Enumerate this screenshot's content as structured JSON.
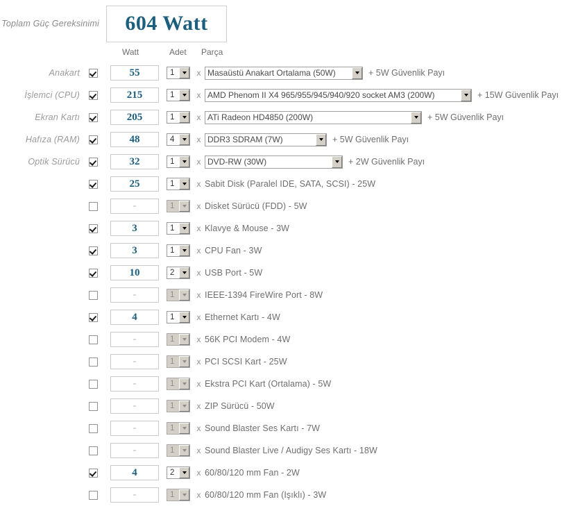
{
  "header": {
    "total_label": "Toplam Güç Gereksinimi",
    "total_value": "604 Watt",
    "accent_color": "#1b5e7e"
  },
  "columns": {
    "watt": "Watt",
    "qty": "Adet",
    "part": "Parça",
    "times": "x"
  },
  "rows": [
    {
      "label": "Anakart",
      "checked": true,
      "watt": "55",
      "qty": "1",
      "part_type": "select",
      "part": "Masaüstü Anakart Ortalama (50W)",
      "select_width": 228,
      "margin": "+ 5W Güvenlik Payı"
    },
    {
      "label": "İşlemci (CPU)",
      "checked": true,
      "watt": "215",
      "qty": "1",
      "part_type": "select",
      "part": "AMD Phenom II X4 965/955/945/940/920 socket AM3 (200W)",
      "select_width": 385,
      "margin": "+ 15W Güvenlik Payı"
    },
    {
      "label": "Ekran Kartı",
      "checked": true,
      "watt": "205",
      "qty": "1",
      "part_type": "select",
      "part": "ATi Radeon HD4850 (200W)",
      "select_width": 313,
      "margin": "+ 5W Güvenlik Payı"
    },
    {
      "label": "Hafıza (RAM)",
      "checked": true,
      "watt": "48",
      "qty": "4",
      "part_type": "select",
      "part": "DDR3 SDRAM (7W)",
      "select_width": 176,
      "margin": "+ 5W Güvenlik Payı"
    },
    {
      "label": "Optik Sürücü",
      "checked": true,
      "watt": "32",
      "qty": "1",
      "part_type": "select",
      "part": "DVD-RW (30W)",
      "select_width": 199,
      "margin": "+ 2W Güvenlik Payı"
    },
    {
      "label": "",
      "checked": true,
      "watt": "25",
      "qty": "1",
      "part_type": "text",
      "part": "Sabit Disk (Paralel IDE, SATA, SCSI) - 25W",
      "margin": ""
    },
    {
      "label": "",
      "checked": false,
      "watt": "-",
      "qty": "1",
      "part_type": "text",
      "part": "Disket Sürücü (FDD) - 5W",
      "margin": ""
    },
    {
      "label": "",
      "checked": true,
      "watt": "3",
      "qty": "1",
      "part_type": "text",
      "part": "Klavye & Mouse - 3W",
      "margin": ""
    },
    {
      "label": "",
      "checked": true,
      "watt": "3",
      "qty": "1",
      "part_type": "text",
      "part": "CPU Fan - 3W",
      "margin": ""
    },
    {
      "label": "",
      "checked": true,
      "watt": "10",
      "qty": "2",
      "part_type": "text",
      "part": "USB Port - 5W",
      "margin": ""
    },
    {
      "label": "",
      "checked": false,
      "watt": "-",
      "qty": "1",
      "part_type": "text",
      "part": "IEEE-1394 FireWire Port - 8W",
      "margin": ""
    },
    {
      "label": "",
      "checked": true,
      "watt": "4",
      "qty": "1",
      "part_type": "text",
      "part": "Ethernet Kartı - 4W",
      "margin": ""
    },
    {
      "label": "",
      "checked": false,
      "watt": "-",
      "qty": "1",
      "part_type": "text",
      "part": "56K PCI Modem - 4W",
      "margin": ""
    },
    {
      "label": "",
      "checked": false,
      "watt": "-",
      "qty": "1",
      "part_type": "text",
      "part": "PCI SCSI Kart - 25W",
      "margin": ""
    },
    {
      "label": "",
      "checked": false,
      "watt": "-",
      "qty": "1",
      "part_type": "text",
      "part": "Ekstra PCI Kart (Ortalama) - 5W",
      "margin": ""
    },
    {
      "label": "",
      "checked": false,
      "watt": "-",
      "qty": "1",
      "part_type": "text",
      "part": "ZIP Sürücü - 50W",
      "margin": ""
    },
    {
      "label": "",
      "checked": false,
      "watt": "-",
      "qty": "1",
      "part_type": "text",
      "part": "Sound Blaster Ses Kartı - 7W",
      "margin": ""
    },
    {
      "label": "",
      "checked": false,
      "watt": "-",
      "qty": "1",
      "part_type": "text",
      "part": "Sound Blaster Live / Audigy Ses Kartı - 18W",
      "margin": ""
    },
    {
      "label": "",
      "checked": true,
      "watt": "4",
      "qty": "2",
      "part_type": "text",
      "part": "60/80/120 mm Fan - 2W",
      "margin": ""
    },
    {
      "label": "",
      "checked": false,
      "watt": "-",
      "qty": "1",
      "part_type": "text",
      "part": "60/80/120 mm Fan (Işıklı) - 3W",
      "margin": ""
    }
  ]
}
